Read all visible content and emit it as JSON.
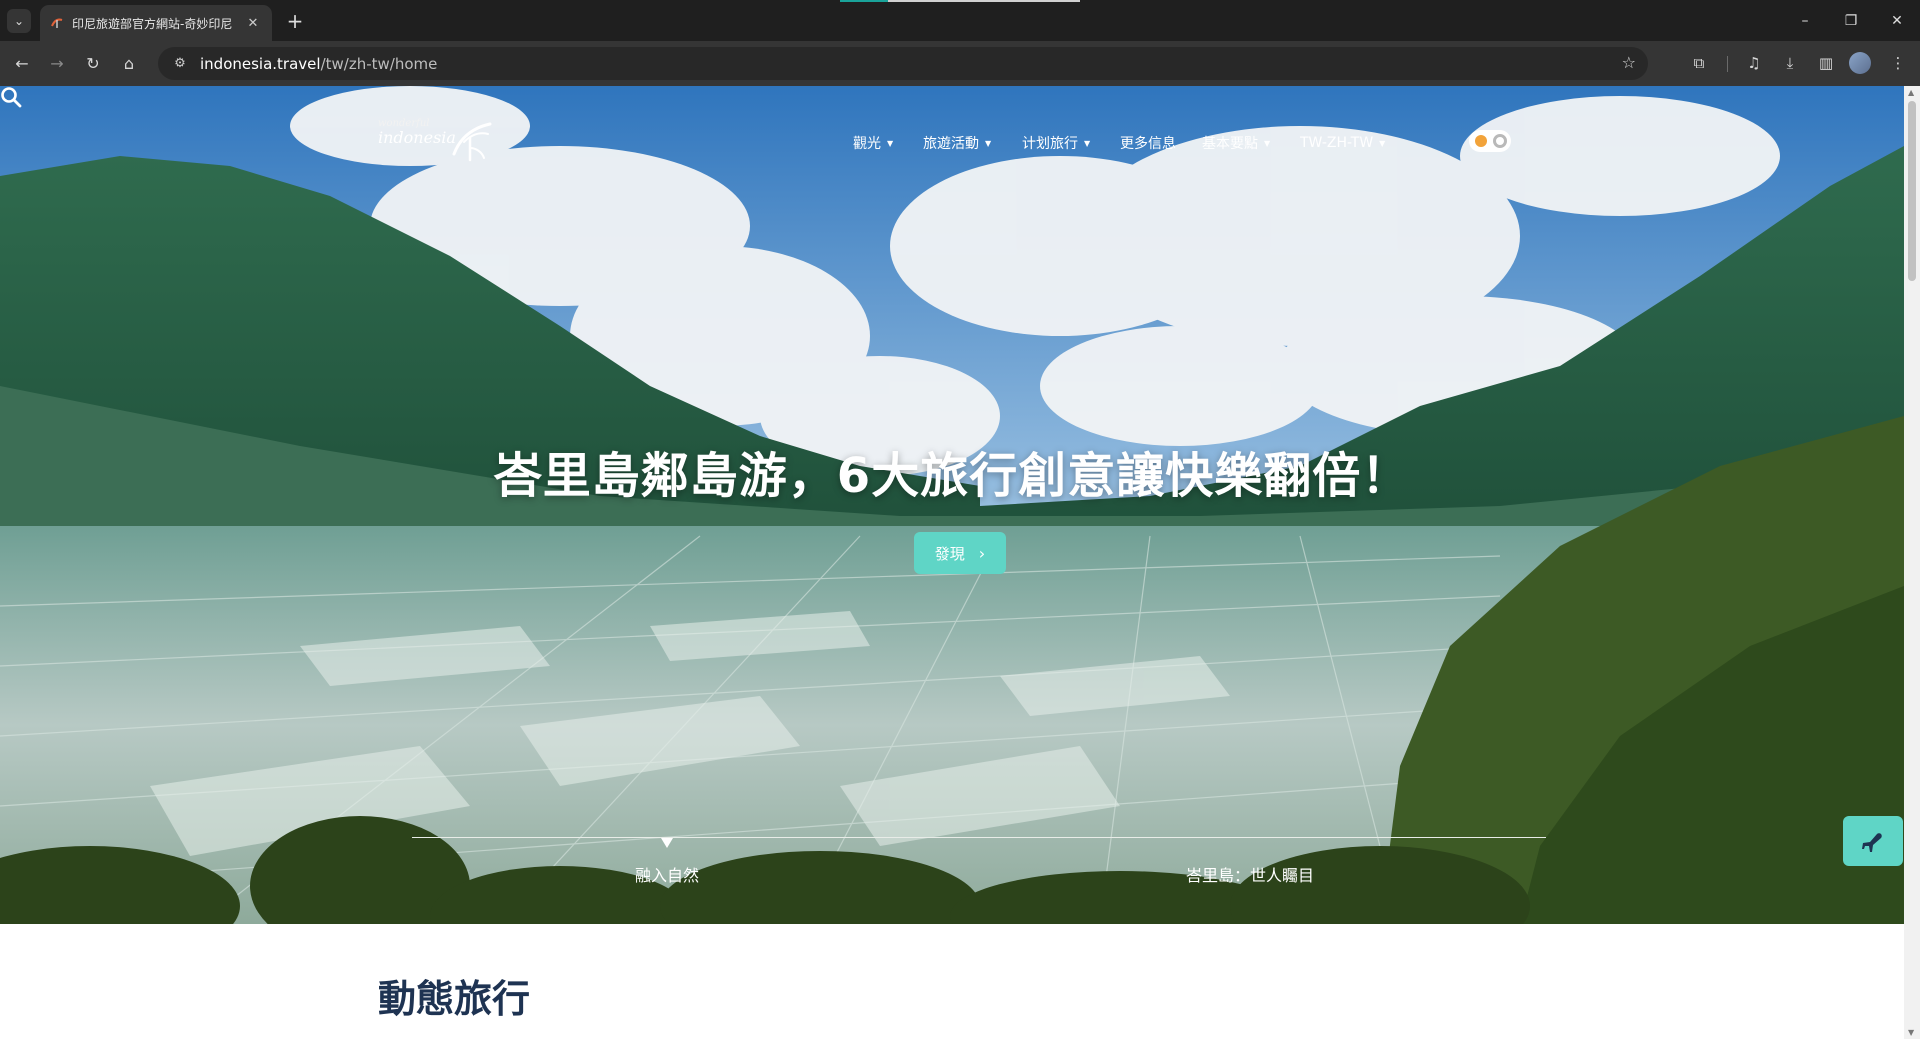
{
  "browser": {
    "tab": {
      "title": "印尼旅遊部官方網站-奇妙印尼",
      "close_glyph": "✕"
    },
    "new_tab_glyph": "+",
    "tab_search_glyph": "⌄",
    "window_controls": {
      "minimize": "–",
      "restore": "❐",
      "close": "✕"
    },
    "nav": {
      "back": "←",
      "forward": "→",
      "reload": "↻",
      "home": "⌂"
    },
    "address": {
      "host": "indonesia.travel",
      "path": "/tw/zh-tw/home"
    }
  },
  "site": {
    "logo": {
      "line1": "wonderful",
      "line2": "indonesia"
    },
    "nav_items": [
      {
        "label": "觀光",
        "has_dropdown": true
      },
      {
        "label": "旅遊活動",
        "has_dropdown": true
      },
      {
        "label": "计划旅行",
        "has_dropdown": true
      },
      {
        "label": "更多信息",
        "has_dropdown": false
      },
      {
        "label": "基本要點",
        "has_dropdown": true
      },
      {
        "label": "TW-ZH-TW",
        "has_dropdown": true
      }
    ],
    "caret_glyph": "▼",
    "icons": {
      "search": "search-icon",
      "theme_toggle": "theme-toggle",
      "float": "airplane-icon"
    }
  },
  "hero": {
    "headline": "峇里島鄰島游，6大旅行創意讓快樂翻倍！",
    "cta_label": "發現",
    "cta_arrow": "›",
    "slides": [
      {
        "label": "融入自然",
        "active": true
      },
      {
        "label": "峇里島：世人矚目",
        "active": false
      }
    ]
  },
  "sections": {
    "first_title": "動態旅行"
  },
  "colors": {
    "accent": "#5fd5c6",
    "title": "#1e3352",
    "chrome_dark": "#1f1f1f",
    "chrome_toolbar": "#353535"
  }
}
